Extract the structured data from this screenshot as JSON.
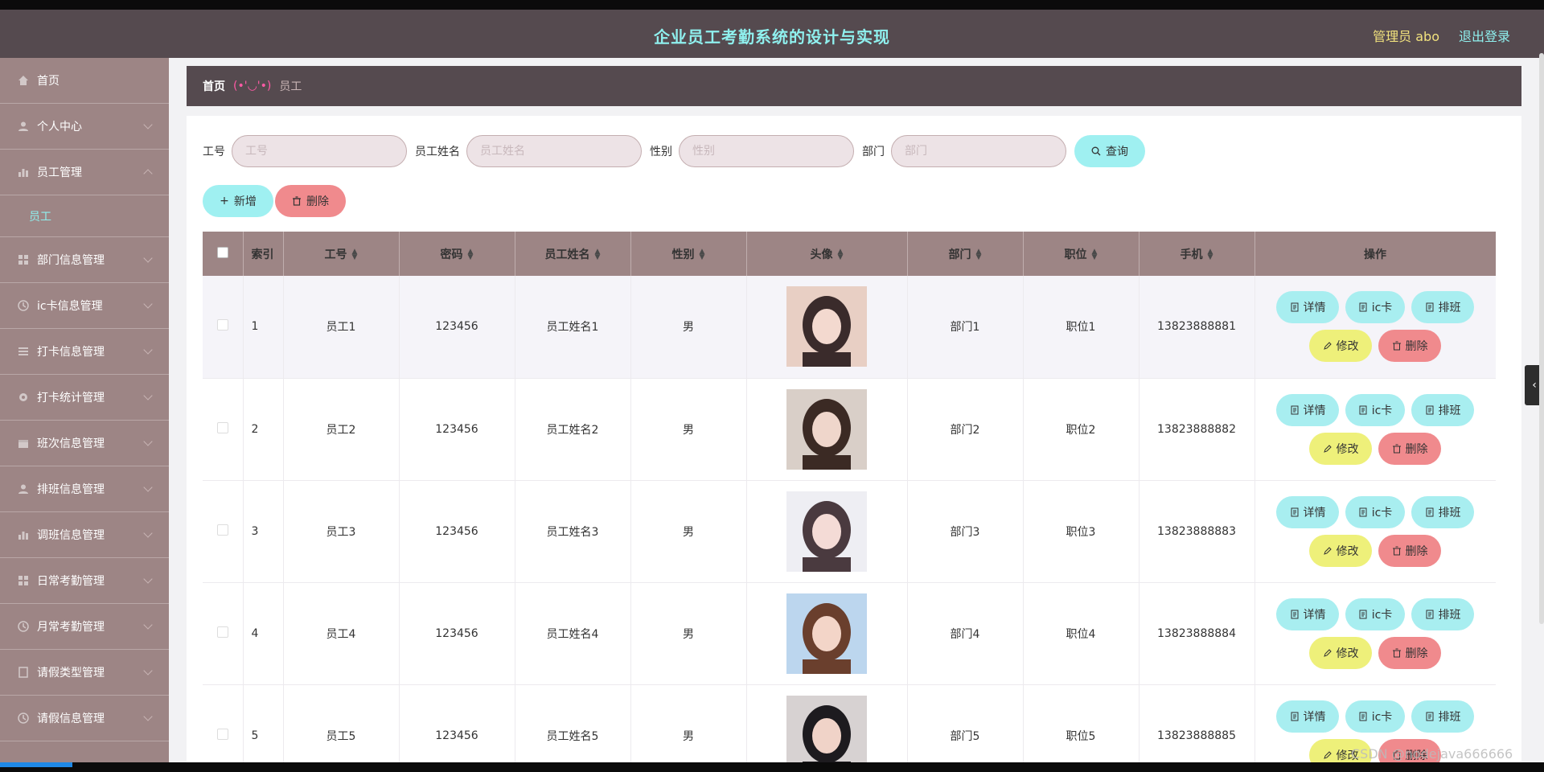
{
  "header": {
    "title": "企业员工考勤系统的设计与实现",
    "admin_label": "管理员 abo",
    "logout_label": "退出登录"
  },
  "sidebar": {
    "items": [
      {
        "label": "首页",
        "icon": "home-icon",
        "arrow": "none"
      },
      {
        "label": "个人中心",
        "icon": "user-icon",
        "arrow": "down"
      },
      {
        "label": "员工管理",
        "icon": "chart-icon",
        "arrow": "up"
      },
      {
        "label": "员工",
        "icon": "",
        "arrow": "none"
      },
      {
        "label": "部门信息管理",
        "icon": "grid-icon",
        "arrow": "down"
      },
      {
        "label": "ic卡信息管理",
        "icon": "clock-icon",
        "arrow": "down"
      },
      {
        "label": "打卡信息管理",
        "icon": "list-icon",
        "arrow": "down"
      },
      {
        "label": "打卡统计管理",
        "icon": "gear-icon",
        "arrow": "down"
      },
      {
        "label": "班次信息管理",
        "icon": "calendar-icon",
        "arrow": "down"
      },
      {
        "label": "排班信息管理",
        "icon": "user-icon",
        "arrow": "down"
      },
      {
        "label": "调班信息管理",
        "icon": "chart-icon",
        "arrow": "down"
      },
      {
        "label": "日常考勤管理",
        "icon": "grid-icon",
        "arrow": "down"
      },
      {
        "label": "月常考勤管理",
        "icon": "clock-icon",
        "arrow": "down"
      },
      {
        "label": "请假类型管理",
        "icon": "doc-icon",
        "arrow": "down"
      },
      {
        "label": "请假信息管理",
        "icon": "clock-icon",
        "arrow": "down"
      }
    ]
  },
  "breadcrumb": {
    "home": "首页",
    "separator": "(•'◡'•)",
    "current": "员工"
  },
  "search": {
    "fields": [
      {
        "label": "工号",
        "placeholder": "工号"
      },
      {
        "label": "员工姓名",
        "placeholder": "员工姓名"
      },
      {
        "label": "性别",
        "placeholder": "性别"
      },
      {
        "label": "部门",
        "placeholder": "部门"
      }
    ],
    "query_label": "查询"
  },
  "actions": {
    "add_label": "新增",
    "delete_label": "删除"
  },
  "table": {
    "columns": [
      "",
      "索引",
      "工号",
      "密码",
      "员工姓名",
      "性别",
      "头像",
      "部门",
      "职位",
      "手机",
      "操作"
    ],
    "rows": [
      {
        "index": "1",
        "emp_no": "员工1",
        "password": "123456",
        "name": "员工姓名1",
        "gender": "男",
        "dept": "部门1",
        "position": "职位1",
        "phone": "13823888881"
      },
      {
        "index": "2",
        "emp_no": "员工2",
        "password": "123456",
        "name": "员工姓名2",
        "gender": "男",
        "dept": "部门2",
        "position": "职位2",
        "phone": "13823888882"
      },
      {
        "index": "3",
        "emp_no": "员工3",
        "password": "123456",
        "name": "员工姓名3",
        "gender": "男",
        "dept": "部门3",
        "position": "职位3",
        "phone": "13823888883"
      },
      {
        "index": "4",
        "emp_no": "员工4",
        "password": "123456",
        "name": "员工姓名4",
        "gender": "男",
        "dept": "部门4",
        "position": "职位4",
        "phone": "13823888884"
      },
      {
        "index": "5",
        "emp_no": "员工5",
        "password": "123456",
        "name": "员工姓名5",
        "gender": "男",
        "dept": "部门5",
        "position": "职位5",
        "phone": "13823888885"
      }
    ],
    "row_actions": {
      "detail": "详情",
      "ic_card": "ic卡",
      "schedule": "排班",
      "edit": "修改",
      "delete": "删除"
    }
  },
  "watermark": "CSDN @nodejava666666",
  "colors": {
    "header_bg": "#554a4f",
    "sidebar_bg": "#9d8585",
    "accent_cyan": "#9ff0f1",
    "accent_red": "#f08a8d",
    "accent_yellow": "#eef07a",
    "title_color": "#8ff0ee"
  }
}
